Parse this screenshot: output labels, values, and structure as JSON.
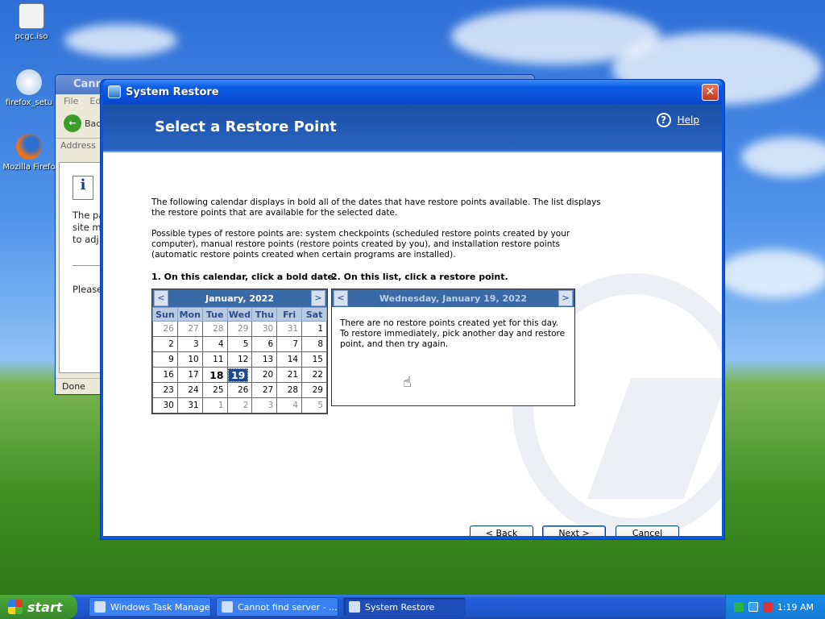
{
  "desktop": {
    "icons": [
      {
        "label": "pcgc.iso"
      },
      {
        "label": "firefox_setu"
      },
      {
        "label": "Mozilla Firefo"
      }
    ]
  },
  "ie_window": {
    "title": "Canno",
    "menu_file": "File",
    "menu_edit": "Ed",
    "back_label": "Bac",
    "address_label": "Address",
    "body_text": "The pa site m to adj",
    "please_text": "Please",
    "status": "Done"
  },
  "dialog": {
    "title": "System Restore",
    "close_symbol": "✕",
    "header_title": "Select a Restore Point",
    "help_symbol": "?",
    "help_label": "Help",
    "intro": "The following calendar displays in bold all of the dates that have restore points available. The list displays the restore points that are available for the selected date.",
    "types": "Possible types of restore points are: system checkpoints (scheduled restore points created by your computer), manual restore points (restore points created by you), and installation restore points (automatic restore points created when certain programs are installed).",
    "step1": "1. On this calendar, click a bold date.",
    "step2": "2. On this list, click a restore point.",
    "calendar": {
      "month": "January, 2022",
      "prev": "<",
      "next": ">",
      "weekdays": [
        "Sun",
        "Mon",
        "Tue",
        "Wed",
        "Thu",
        "Fri",
        "Sat"
      ],
      "weeks": [
        [
          {
            "d": "26",
            "o": true
          },
          {
            "d": "27",
            "o": true
          },
          {
            "d": "28",
            "o": true
          },
          {
            "d": "29",
            "o": true
          },
          {
            "d": "30",
            "o": true
          },
          {
            "d": "31",
            "o": true
          },
          {
            "d": "1"
          }
        ],
        [
          {
            "d": "2"
          },
          {
            "d": "3"
          },
          {
            "d": "4"
          },
          {
            "d": "5"
          },
          {
            "d": "6"
          },
          {
            "d": "7"
          },
          {
            "d": "8"
          }
        ],
        [
          {
            "d": "9"
          },
          {
            "d": "10"
          },
          {
            "d": "11"
          },
          {
            "d": "12"
          },
          {
            "d": "13"
          },
          {
            "d": "14"
          },
          {
            "d": "15"
          }
        ],
        [
          {
            "d": "16"
          },
          {
            "d": "17"
          },
          {
            "d": "18",
            "b": true
          },
          {
            "d": "19",
            "s": true
          },
          {
            "d": "20"
          },
          {
            "d": "21"
          },
          {
            "d": "22"
          }
        ],
        [
          {
            "d": "23"
          },
          {
            "d": "24"
          },
          {
            "d": "25"
          },
          {
            "d": "26"
          },
          {
            "d": "27"
          },
          {
            "d": "28"
          },
          {
            "d": "29"
          }
        ],
        [
          {
            "d": "30"
          },
          {
            "d": "31"
          },
          {
            "d": "1",
            "o": true
          },
          {
            "d": "2",
            "o": true
          },
          {
            "d": "3",
            "o": true
          },
          {
            "d": "4",
            "o": true
          },
          {
            "d": "5",
            "o": true
          }
        ]
      ]
    },
    "list": {
      "date": "Wednesday, January 19, 2022",
      "prev": "<",
      "next": ">",
      "message": "There are no restore points created yet for this day. To restore immediately, pick another day and restore point, and then try again."
    },
    "buttons": {
      "back": "< Back",
      "next": "Next >",
      "cancel": "Cancel"
    }
  },
  "taskbar": {
    "start_label": "start",
    "items": [
      {
        "label": "Windows Task Manager"
      },
      {
        "label": "Cannot find server - ..."
      },
      {
        "label": "System Restore"
      }
    ],
    "clock": "1:19 AM"
  }
}
